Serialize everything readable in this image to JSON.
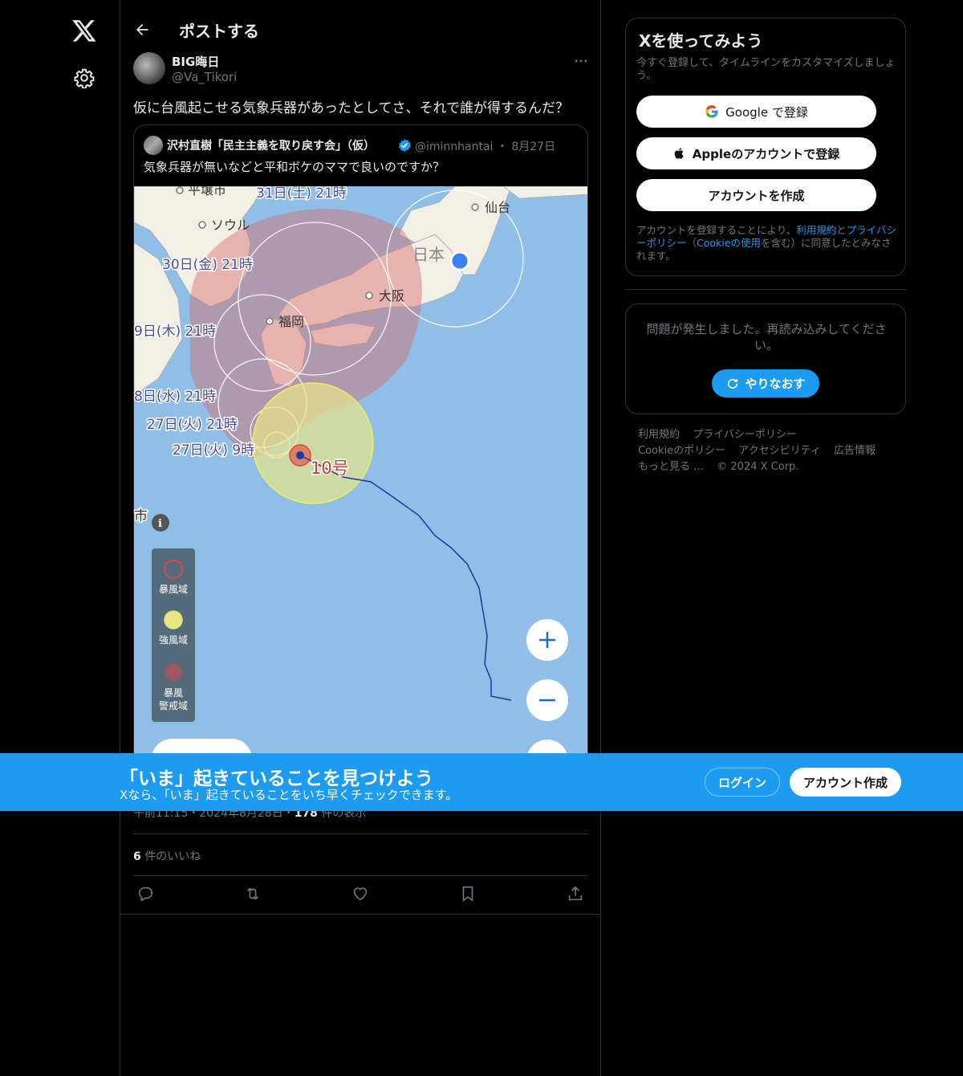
{
  "header": {
    "title": "ポストする"
  },
  "post": {
    "author_name": "BIG晦日",
    "author_handle": "@Va_Tikori",
    "text": "仮に台風起こせる気象兵器があったとしてさ、それで誰が得するんだ？",
    "meta_time": "午前11:15・2024年8月28日・",
    "views_count": "178",
    "views_label": "件の表示",
    "likes_count": "6",
    "likes_label": "件のいいね"
  },
  "quote": {
    "author_name": "沢村直樹「民主主義を取り戻す会」（仮）",
    "author_handle": "@iminnhantai",
    "date": "・ 8月27日",
    "text": "気象兵器が無いなどと平和ボケのママで良いのですか？"
  },
  "map": {
    "cities": [
      "平壌市",
      "ソウル",
      "仙台",
      "日本",
      "大阪",
      "福岡"
    ],
    "time_labels": [
      "31日(土) 21時",
      "30日(金) 21時",
      "9日(木) 21時",
      "8日(水) 21時",
      "27日(火) 21時",
      "27日(火) 9時"
    ],
    "typhoon_label": "10号",
    "edge_label": "市",
    "legend": [
      "暴風域",
      "強風域",
      "暴風",
      "警戒域"
    ],
    "colors": {
      "sea": "#8fbfe8",
      "land": "#f2efe6",
      "storm": "#e0463c",
      "strong_wind": "#f0ef5a",
      "track": "#1a3aa0"
    }
  },
  "signup": {
    "title": "Xを使ってみよう",
    "subtitle": "今すぐ登録して、タイムラインをカスタマイズしましょう。",
    "google_label": "Google で登録",
    "apple_label": "Appleのアカウントで登録",
    "create_label": "アカウントを作成",
    "legal_prefix": "アカウントを登録することにより、",
    "legal_terms": "利用規約",
    "legal_and": "と",
    "legal_privacy": "プライバシーポリシー",
    "legal_paren_open": "（",
    "legal_cookie": "Cookieの使用",
    "legal_suffix": "を含む）に同意したとみなされます。"
  },
  "error_box": {
    "text": "問題が発生しました。再読み込みしてください。",
    "retry_label": "やりなおす"
  },
  "footer": {
    "links": [
      "利用規約",
      "プライバシーポリシー",
      "Cookieのポリシー",
      "アクセシビリティ",
      "広告情報",
      "もっと見る …",
      "© 2024 X Corp."
    ]
  },
  "banner": {
    "title": "「いま」起きていることを見つけよう",
    "subtitle": "Xなら、「いま」起きていることをいち早くチェックできます。",
    "login_label": "ログイン",
    "create_label": "アカウント作成"
  }
}
